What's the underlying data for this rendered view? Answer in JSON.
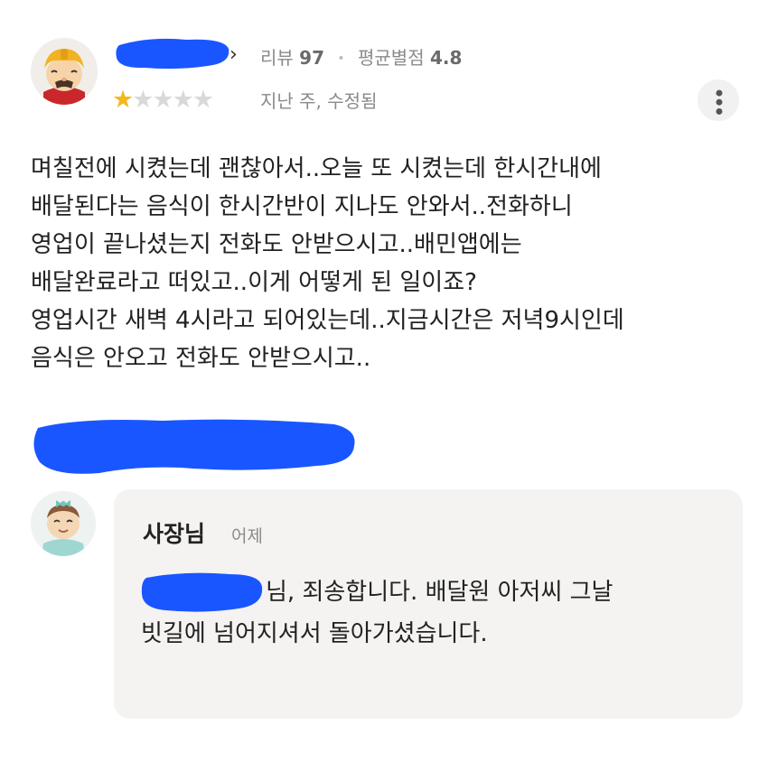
{
  "review": {
    "chevron": "›",
    "meta": {
      "review_label": "리뷰",
      "review_count": "97",
      "separator": "•",
      "avg_label": "평균별점",
      "avg_value": "4.8"
    },
    "rating": 1,
    "rating_max": 5,
    "edited_text": "지난 주, 수정됨",
    "more_icon": "more-vertical-icon",
    "body_lines": [
      "며칠전에 시켰는데 괜찮아서..오늘 또 시켰는데 한시간내에",
      "배달된다는 음식이 한시간반이 지나도 안와서..전화하니",
      "영업이 끝나셨는지 전화도 안받으시고..배민앱에는",
      "배달완료라고 떠있고..이게 어떻게 된 일이죠?",
      "영업시간 새벽 4시라고 되어있는데..지금시간은 저녁9시인데",
      "음식은 안오고 전화도 안받으시고.."
    ]
  },
  "reply": {
    "owner_name": "사장님",
    "date": "어제",
    "line1_text": "님, 죄송합니다. 배달원 아저씨 그날",
    "line2_text": "빗길에  넘어지셔서 돌아가셨습니다."
  },
  "colors": {
    "star_on": "#f5b71b",
    "star_off": "#d9d9d9",
    "redaction": "#1a56ff",
    "reply_bg": "#f4f3f1"
  }
}
